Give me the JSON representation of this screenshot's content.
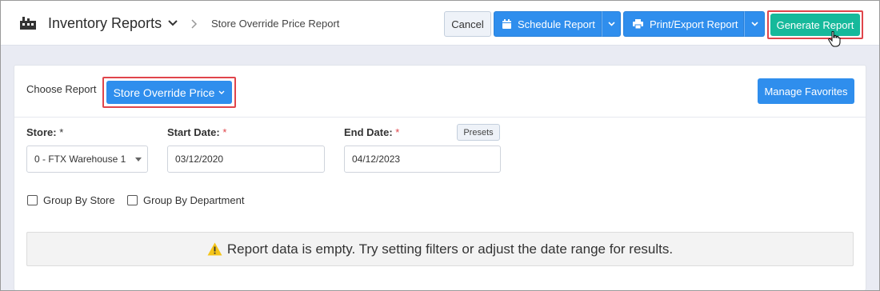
{
  "header": {
    "app_title": "Inventory Reports",
    "breadcrumb": "Store Override Price Report",
    "cancel_label": "Cancel",
    "schedule_label": "Schedule Report",
    "print_label": "Print/Export Report",
    "generate_label": "Generate Report"
  },
  "main": {
    "choose_label": "Choose Report",
    "selected_report": "Store Override Price",
    "manage_favorites_label": "Manage Favorites",
    "fields": {
      "store": {
        "label": "Store:",
        "required_mark": "*",
        "value": "0 - FTX Warehouse 1"
      },
      "start_date": {
        "label": "Start Date:",
        "required_mark": "*",
        "value": "03/12/2020"
      },
      "end_date": {
        "label": "End Date:",
        "required_mark": "*",
        "value": "04/12/2023"
      }
    },
    "presets_label": "Presets",
    "checkboxes": [
      {
        "label": "Group By Store",
        "checked": false
      },
      {
        "label": "Group By Department",
        "checked": false
      }
    ],
    "empty_message": "Report data is empty. Try setting filters or adjust the date range for results."
  },
  "colors": {
    "primary_blue": "#2f8eed",
    "generate_green": "#16b99b",
    "highlight_red": "#e0454b",
    "warning_yellow": "#f5c518"
  },
  "icons": [
    "inventory-app-icon",
    "chevron-down-icon",
    "chevron-right-icon",
    "calendar-icon",
    "printer-icon",
    "pointer-hand-icon",
    "warning-icon"
  ]
}
